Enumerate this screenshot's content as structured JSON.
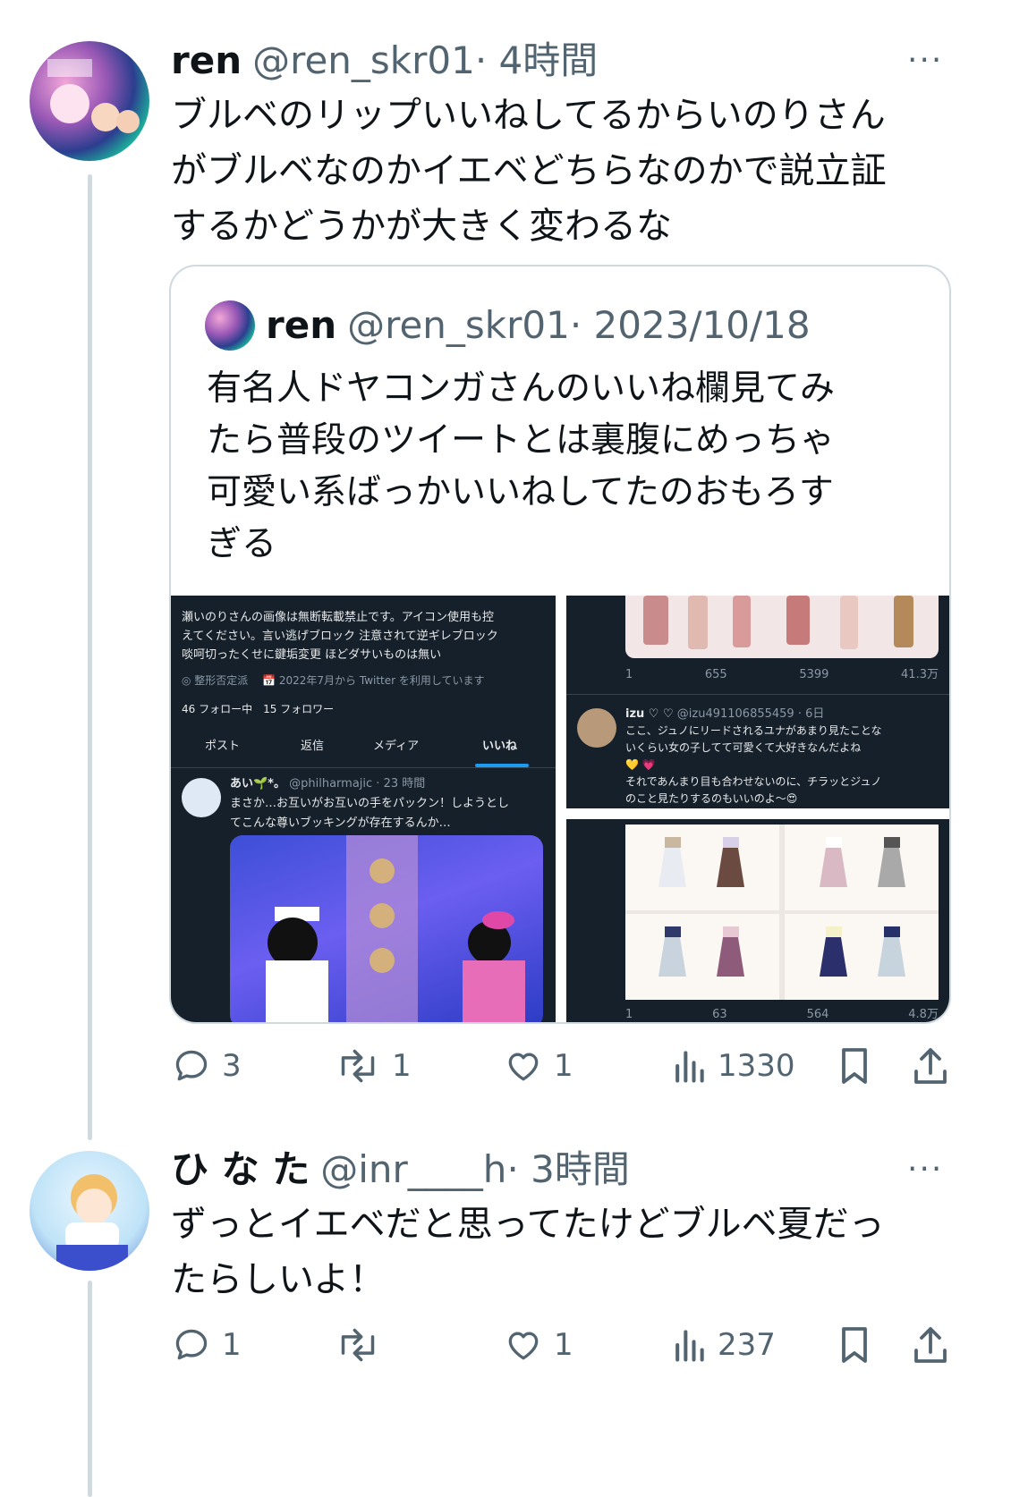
{
  "tweet1": {
    "name": "ren",
    "handle": "@ren_skr01",
    "time": "· 4時間",
    "more": "···",
    "text_lines": [
      "ブルベのリップいいねしてるからいのりさん",
      "がブルベなのかイエベどちらなのかで説立証",
      "するかどうかが大きく変わるな"
    ],
    "quote": {
      "name": "ren",
      "handle": "@ren_skr01",
      "date": "· 2023/10/18",
      "text_lines": [
        "有名人ドヤコンガさんのいいね欄見てみ",
        "たら普段のツイートとは裏腹にめっちゃ",
        "可愛い系ばっかいいねしてたのおもろす",
        "ぎる"
      ],
      "shot1": {
        "bio_lines": [
          "瀬いのりさんの画像は無断転載禁止です。アイコン使用も控",
          "えてください。言い逃げブロック 注意されて逆ギレブロック",
          "啖呵切ったくせに鍵垢変更 ほどダサいものは無い"
        ],
        "meta": "◎ 整形否定派　 📅 2022年7月から Twitter を利用しています",
        "follow": "46 フォロー中　15 フォロワー",
        "tabs": [
          "ポスト",
          "返信",
          "メディア",
          "いいね"
        ],
        "tweet_name": "あい🌱*。",
        "tweet_meta": "@philharmajic · 23 時間",
        "tweet_lines": [
          "まさか…お互いがお互いの手をパックン！しようとし",
          "てこんな尊いブッキングが存在するんか…"
        ]
      },
      "shot2": {
        "stats": [
          "1",
          "655",
          "5399",
          "41.3万"
        ],
        "tweet_name": "izu ♡ ♡",
        "tweet_meta": "@izu491106855459 · 6日",
        "tweet_lines": [
          "ここ、ジュノにリードされるユナがあまり見たことな",
          "いくらい女の子してて可愛くて大好きなんだよね",
          "💛 💗",
          "それであんまり目も合わせないのに、チラッとジュノ",
          "のこと見たりするのもいいのよ〜😍"
        ]
      },
      "shot3": {
        "stats": [
          "1",
          "63",
          "564",
          "4.8万"
        ]
      }
    },
    "actions": {
      "reply": "3",
      "retweet": "1",
      "like": "1",
      "views": "1330"
    }
  },
  "tweet2": {
    "name": "ひ な た",
    "handle": "@inr____h",
    "time": "· 3時間",
    "more": "···",
    "text_lines": [
      "ずっとイエベだと思ってたけどブルベ夏だっ",
      "たらしいよ！"
    ],
    "actions": {
      "reply": "1",
      "retweet": "",
      "like": "1",
      "views": "237"
    }
  },
  "colors": {
    "text": "#0f1419",
    "muted": "#536471",
    "line": "#cfd9de",
    "dark_bg": "#15202b"
  }
}
